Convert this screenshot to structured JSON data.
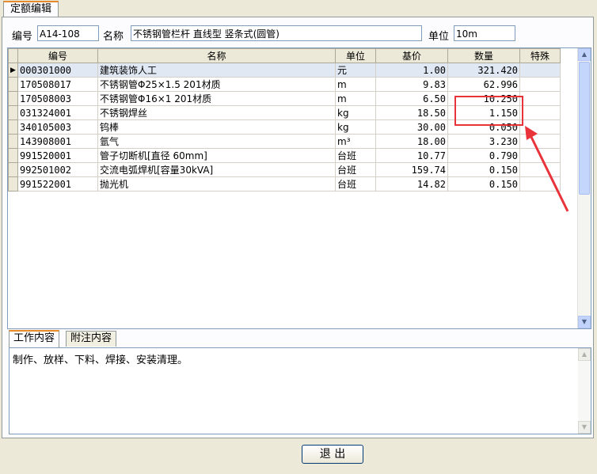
{
  "tab": {
    "label": "定额编辑"
  },
  "top": {
    "code_label": "编号",
    "code_value": "A14-108",
    "name_label": "名称",
    "name_value": "不锈钢管栏杆 直线型 竖条式(圆管)",
    "unit_label": "单位",
    "unit_value": "10m"
  },
  "grid": {
    "headers": [
      "编号",
      "名称",
      "单位",
      "基价",
      "数量",
      "特殊"
    ],
    "rows": [
      {
        "code": "000301000",
        "name": "建筑装饰人工",
        "unit": "元",
        "price": "1.00",
        "qty": "321.420",
        "special": ""
      },
      {
        "code": "170508017",
        "name": "不锈钢管Φ25×1.5 201材质",
        "unit": "m",
        "price": "9.83",
        "qty": "62.996",
        "special": ""
      },
      {
        "code": "170508003",
        "name": "不锈钢管Φ16×1 201材质",
        "unit": "m",
        "price": "6.50",
        "qty": "10.250",
        "special": ""
      },
      {
        "code": "031324001",
        "name": "不锈钢焊丝",
        "unit": "kg",
        "price": "18.50",
        "qty": "1.150",
        "special": ""
      },
      {
        "code": "340105003",
        "name": "钨棒",
        "unit": "kg",
        "price": "30.00",
        "qty": "0.050",
        "special": ""
      },
      {
        "code": "143908001",
        "name": "氩气",
        "unit": "m³",
        "price": "18.00",
        "qty": "3.230",
        "special": ""
      },
      {
        "code": "991520001",
        "name": "管子切断机[直径 60mm]",
        "unit": "台班",
        "price": "10.77",
        "qty": "0.790",
        "special": ""
      },
      {
        "code": "992501002",
        "name": "交流电弧焊机[容量30kVA]",
        "unit": "台班",
        "price": "159.74",
        "qty": "0.150",
        "special": ""
      },
      {
        "code": "991522001",
        "name": "抛光机",
        "unit": "台班",
        "price": "14.82",
        "qty": "0.150",
        "special": ""
      }
    ]
  },
  "bottom_tabs": [
    "工作内容",
    "附注内容"
  ],
  "work_content": "制作、放样、下料、焊接、安装清理。",
  "exit_label": "退 出",
  "colors": {
    "highlight": "#e8333a",
    "tab_accent": "#e68b2c"
  }
}
